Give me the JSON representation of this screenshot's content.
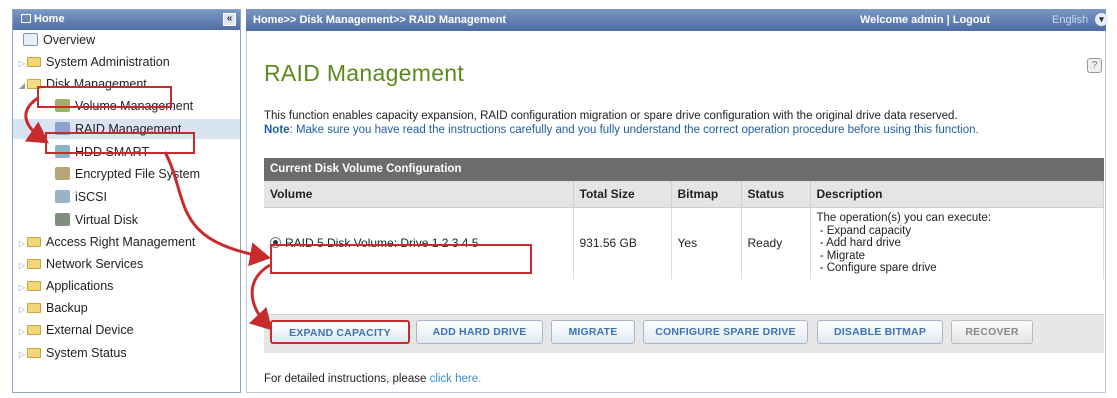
{
  "sidebar": {
    "home": "Home",
    "items": [
      {
        "label": "Overview"
      },
      {
        "label": "System Administration"
      },
      {
        "label": "Disk Management"
      },
      {
        "label": "Volume Management"
      },
      {
        "label": "RAID Management"
      },
      {
        "label": "HDD SMART"
      },
      {
        "label": "Encrypted File System"
      },
      {
        "label": "iSCSI"
      },
      {
        "label": "Virtual Disk"
      },
      {
        "label": "Access Right Management"
      },
      {
        "label": "Network Services"
      },
      {
        "label": "Applications"
      },
      {
        "label": "Backup"
      },
      {
        "label": "External Device"
      },
      {
        "label": "System Status"
      }
    ]
  },
  "topbar": {
    "breadcrumb": "Home>> Disk Management>> RAID Management",
    "welcome": "Welcome admin | ",
    "logout": "Logout",
    "language": "English"
  },
  "main": {
    "title": "RAID Management",
    "description": "This function enables capacity expansion, RAID configuration migration or spare drive configuration with the original drive data reserved.",
    "note_label": "Note",
    "note_text": ": Make sure you have read the instructions carefully and you fully understand the correct operation procedure before using this function.",
    "panel_title": "Current Disk Volume Configuration",
    "columns": [
      "Volume",
      "Total Size",
      "Bitmap",
      "Status",
      "Description"
    ],
    "row": {
      "volume": "RAID 5 Disk Volume: Drive  1 2 3 4 5",
      "total_size": "931.56 GB",
      "bitmap": "Yes",
      "status": "Ready",
      "description": "The operation(s) you can execute:\n - Expand capacity\n - Add hard drive\n - Migrate\n - Configure spare drive"
    },
    "buttons": [
      "EXPAND CAPACITY",
      "ADD HARD DRIVE",
      "MIGRATE",
      "CONFIGURE SPARE DRIVE",
      "DISABLE BITMAP",
      "RECOVER"
    ],
    "footer_text": "For detailed instructions, please ",
    "footer_link": "click here."
  },
  "colors": {
    "accent_green": "#5a8a1c",
    "header_blue": "#4f6ea4",
    "highlight_red": "#c82b2b",
    "link_blue": "#3a73b8"
  }
}
